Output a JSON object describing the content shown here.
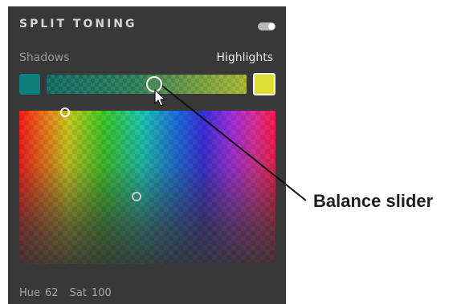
{
  "panel": {
    "title": "SPLIT TONING",
    "toggle_state": "on",
    "shadows_label": "Shadows",
    "highlights_label": "Highlights",
    "shadow_swatch_color": "#0e7f7a",
    "highlight_swatch_color": "#dede33",
    "balance_value": 0.54,
    "hue_label": "Hue",
    "hue_value": "62",
    "sat_label": "Sat",
    "sat_value": "100"
  },
  "callout": {
    "label": "Balance slider"
  },
  "icons": {
    "pointer": "arrow-cursor-icon",
    "toggle": "toggle-switch-icon"
  }
}
